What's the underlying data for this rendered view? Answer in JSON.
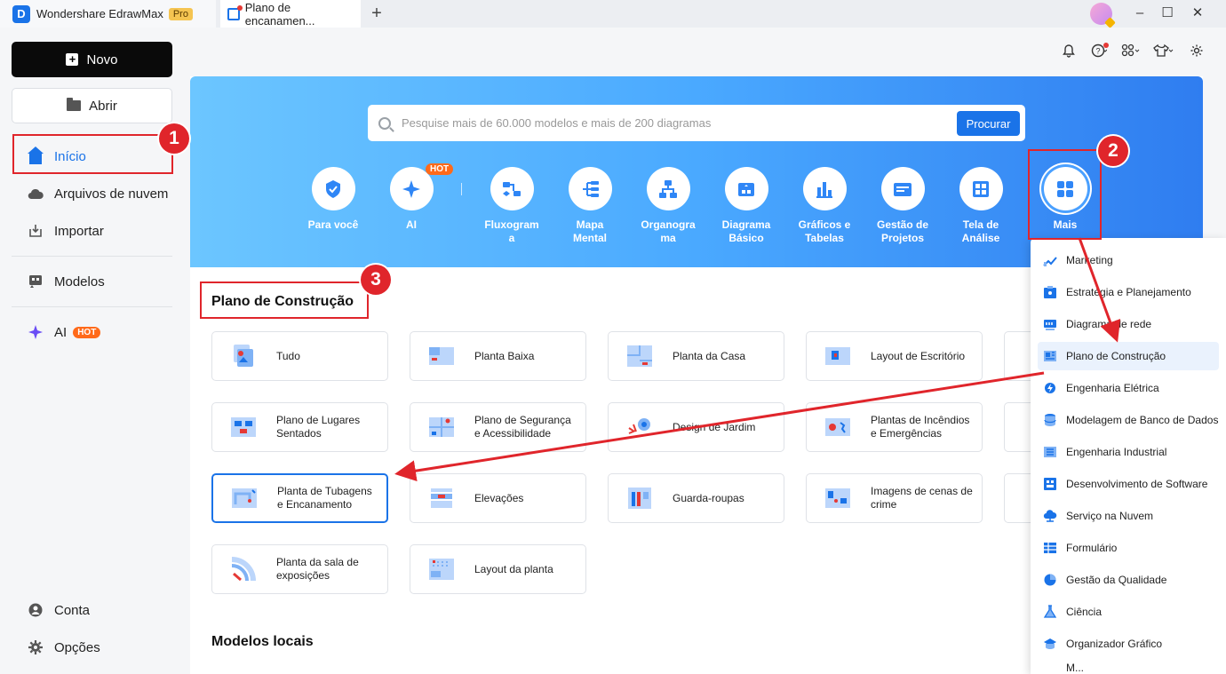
{
  "titlebar": {
    "app_name": "Wondershare EdrawMax",
    "pro": "Pro",
    "doc_tab": "Plano de encanamen...",
    "add_tab": "+",
    "minimize": "–",
    "maximize": "☐",
    "close": "✕"
  },
  "sidebar": {
    "new": "Novo",
    "open": "Abrir",
    "home": "Início",
    "cloud": "Arquivos de nuvem",
    "import": "Importar",
    "templates": "Modelos",
    "ai": "AI",
    "ai_hot": "HOT",
    "account": "Conta",
    "options": "Opções"
  },
  "search": {
    "placeholder": "Pesquise mais de 60.000 modelos e mais de 200 diagramas",
    "button": "Procurar"
  },
  "categories": {
    "for_you": "Para você",
    "ai": "AI",
    "ai_hot": "HOT",
    "flowchart_l1": "Fluxogram",
    "flowchart_l2": "a",
    "mindmap_l1": "Mapa",
    "mindmap_l2": "Mental",
    "org_l1": "Organogra",
    "org_l2": "ma",
    "basic_l1": "Diagrama",
    "basic_l2": "Básico",
    "charts_l1": "Gráficos e",
    "charts_l2": "Tabelas",
    "pm_l1": "Gestão de",
    "pm_l2": "Projetos",
    "canvas_l1": "Tela de",
    "canvas_l2": "Análise",
    "more": "Mais"
  },
  "section": {
    "title": "Plano de Construção",
    "local_title": "Modelos locais"
  },
  "tiles": [
    {
      "l1": "Tudo",
      "l2": ""
    },
    {
      "l1": "Planta Baixa",
      "l2": ""
    },
    {
      "l1": "Planta da Casa",
      "l2": ""
    },
    {
      "l1": "Layout de Escritório",
      "l2": ""
    },
    {
      "l1": "Plano de Lugares",
      "l2": "Sentados"
    },
    {
      "l1": "Plano de Segurança",
      "l2": "e Acessibilidade"
    },
    {
      "l1": "Design de Jardim",
      "l2": ""
    },
    {
      "l1": "Plantas de Incêndios",
      "l2": "e Emergências"
    },
    {
      "l1": "Planta de Tubagens",
      "l2": "e Encanamento"
    },
    {
      "l1": "Elevações",
      "l2": ""
    },
    {
      "l1": "Guarda-roupas",
      "l2": ""
    },
    {
      "l1": "Imagens de cenas de",
      "l2": "crime"
    },
    {
      "l1": "Planta da sala de",
      "l2": "exposições"
    },
    {
      "l1": "Layout da planta",
      "l2": ""
    }
  ],
  "dropdown": [
    "Marketing",
    "Estratégia e Planejamento",
    "Diagrama de rede",
    "Plano de Construção",
    "Engenharia Elétrica",
    "Modelagem de Banco de Dados",
    "Engenharia Industrial",
    "Desenvolvimento de Software",
    "Serviço na Nuvem",
    "Formulário",
    "Gestão da Qualidade",
    "Ciência",
    "Organizador Gráfico",
    "M..."
  ],
  "annotations": {
    "n1": "1",
    "n2": "2",
    "n3": "3"
  },
  "colors": {
    "accent": "#1a73e8",
    "annotation": "#e0252b",
    "hot": "#ff6a1a"
  }
}
